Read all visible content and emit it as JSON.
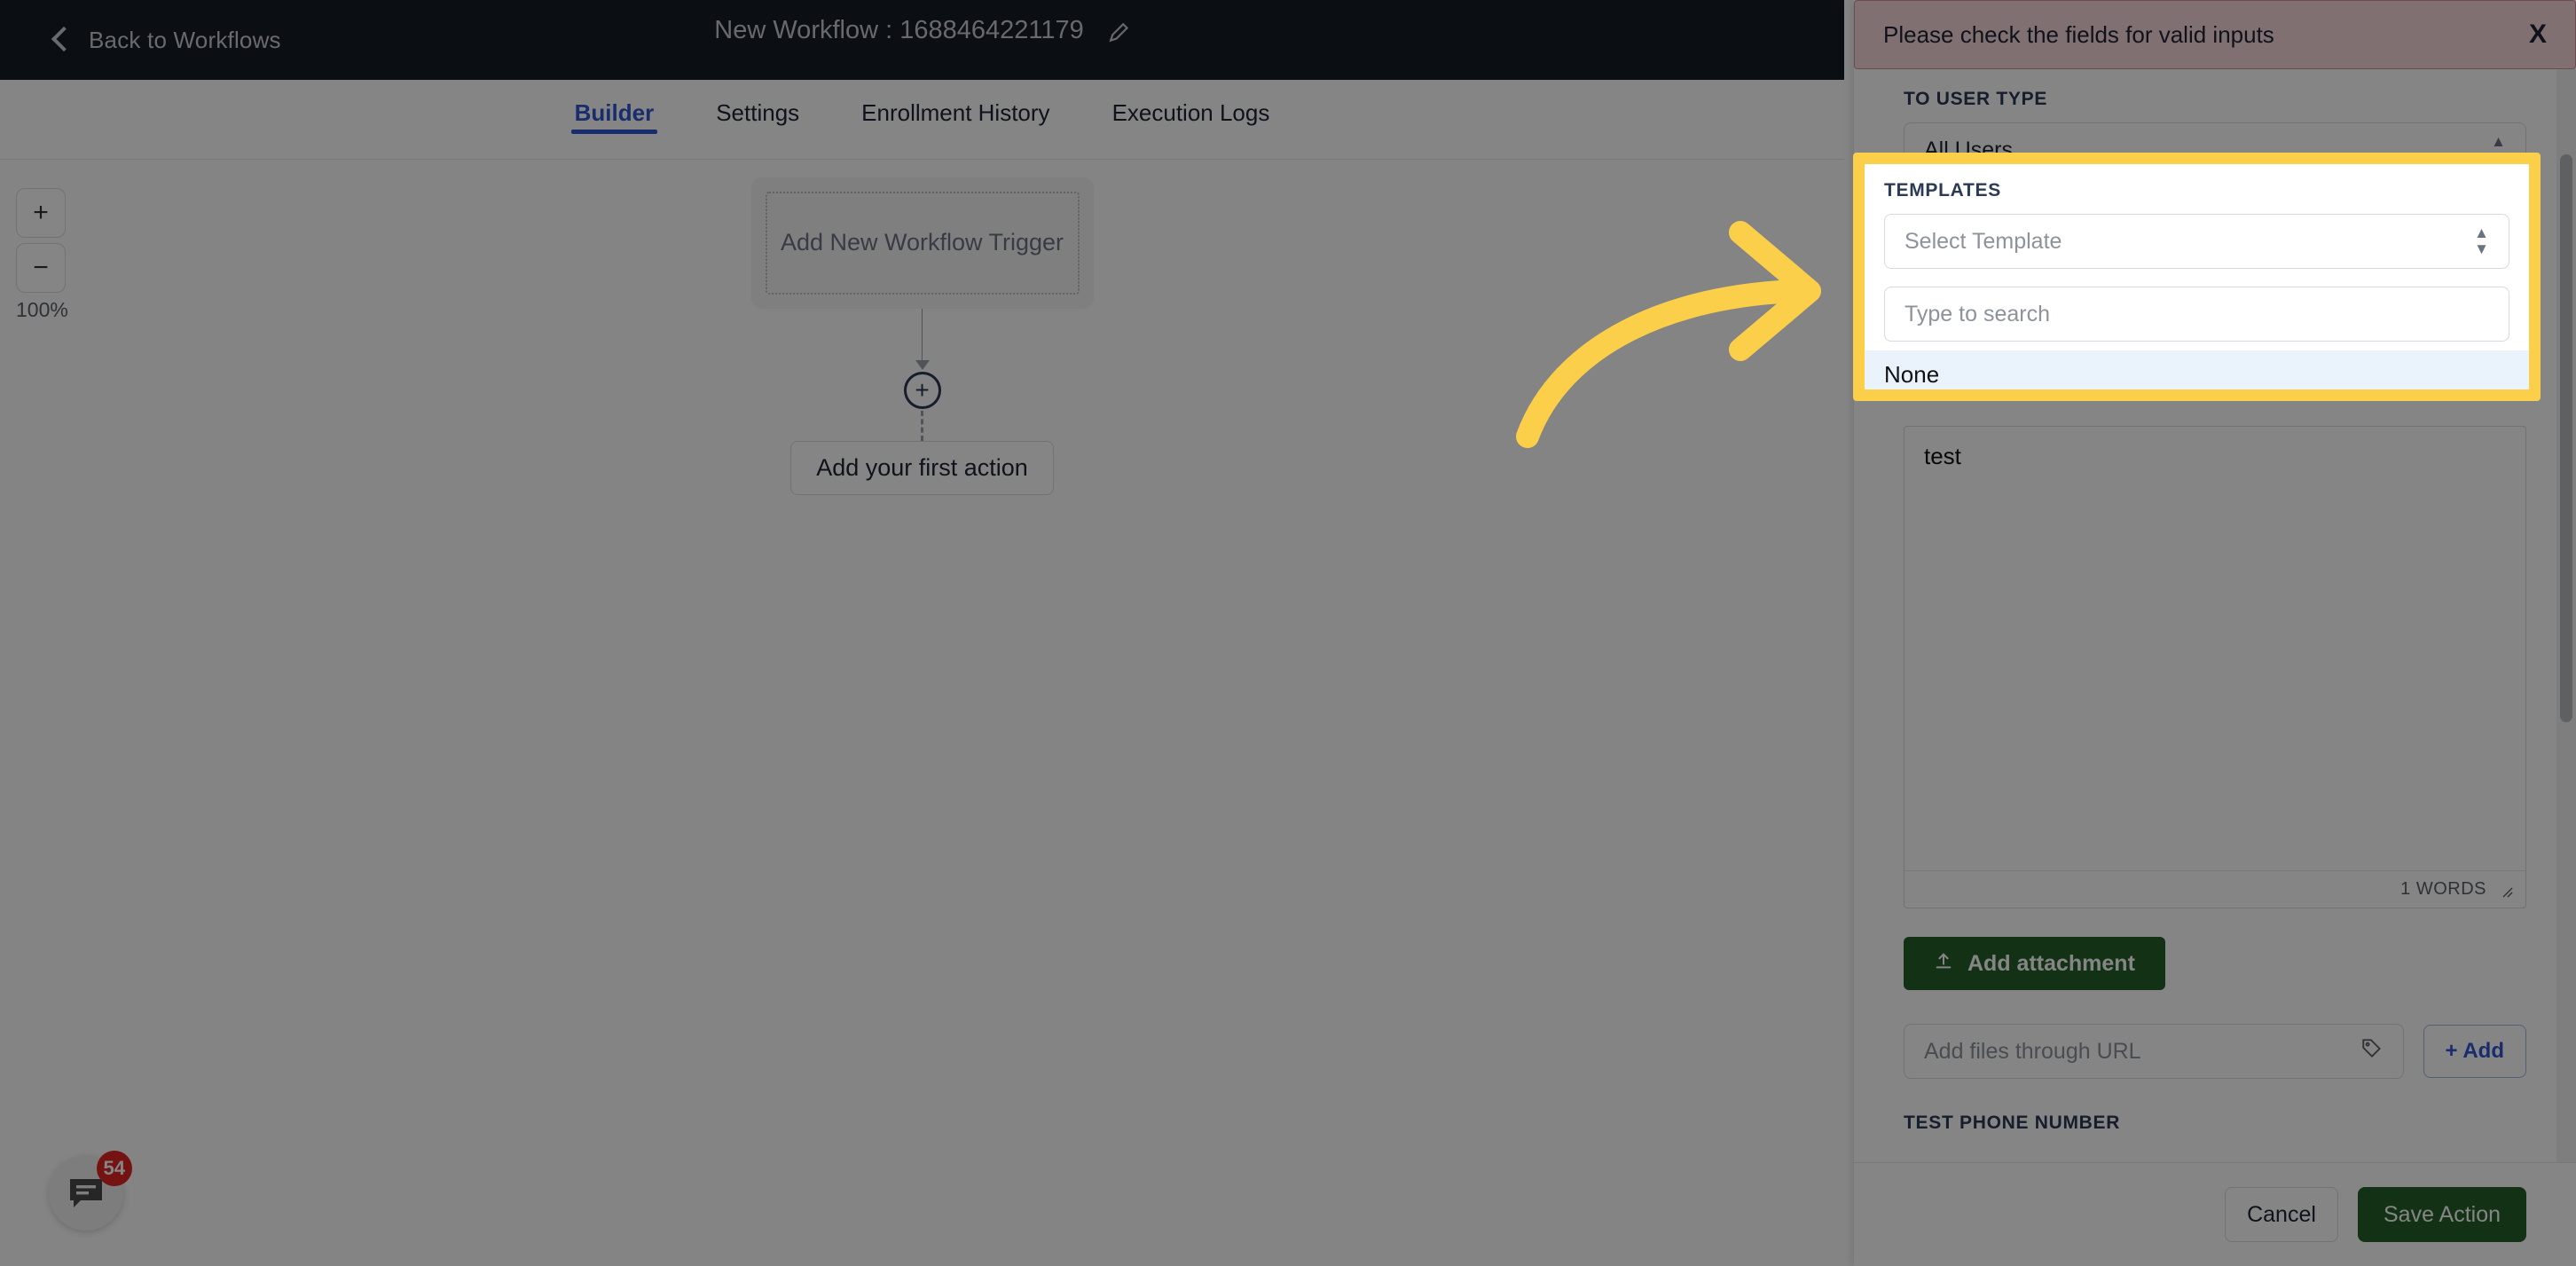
{
  "topbar": {
    "back_label": "Back to Workflows",
    "title": "New Workflow : 1688464221179",
    "edit_icon": "pencil-icon"
  },
  "tabs": [
    {
      "label": "Builder",
      "active": true
    },
    {
      "label": "Settings",
      "active": false
    },
    {
      "label": "Enrollment History",
      "active": false
    },
    {
      "label": "Execution Logs",
      "active": false
    }
  ],
  "canvas": {
    "zoom_in": "+",
    "zoom_out": "−",
    "zoom_level": "100%",
    "trigger_placeholder": "Add New Workflow Trigger",
    "add_node": "+",
    "first_action_label": "Add your first action"
  },
  "chat": {
    "badge": "54",
    "icon": "chat-bubble-icon"
  },
  "panel": {
    "alert": {
      "message": "Please check the fields for valid inputs",
      "close_icon": "close-icon",
      "close_label": "X"
    },
    "to_user_type": {
      "label": "TO USER TYPE",
      "value": "All Users"
    },
    "templates": {
      "label": "TEMPLATES",
      "select_value": "Select Template",
      "search_placeholder": "Type to search",
      "options": [
        "None"
      ],
      "highlighted_option": "None"
    },
    "editor": {
      "value": "test",
      "word_count": "1 WORDS"
    },
    "attachment": {
      "button_label": "Add attachment",
      "icon": "upload-icon"
    },
    "url_row": {
      "placeholder": "Add files through URL",
      "tag_icon": "tag-icon",
      "add_label": "+ Add"
    },
    "test_phone": {
      "label": "TEST PHONE NUMBER"
    },
    "footer": {
      "cancel_label": "Cancel",
      "save_label": "Save Action"
    }
  },
  "annotation": {
    "arrow": "curved-arrow-right",
    "highlight_color": "#fbcf4a"
  },
  "colors": {
    "topbar_bg": "#161b25",
    "accent_blue": "#2f55d4",
    "green": "#256029",
    "alert_bg": "#f7d7d9",
    "badge_red": "#e02424",
    "highlight_yellow": "#fbcf4a"
  }
}
